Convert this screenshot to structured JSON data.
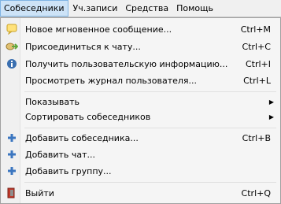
{
  "menubar": {
    "items": [
      {
        "label": "Собеседники",
        "active": true
      },
      {
        "label": "Уч.записи"
      },
      {
        "label": "Средства"
      },
      {
        "label": "Помощь"
      }
    ]
  },
  "menu": {
    "new_message": {
      "label": "Новое мгновенное сообщение...",
      "shortcut": "Ctrl+M",
      "icon": "new-message-icon"
    },
    "join_chat": {
      "label": "Присоединиться к чату...",
      "shortcut": "Ctrl+C",
      "icon": "join-chat-icon"
    },
    "user_info": {
      "label": "Получить пользовательскую информацию...",
      "shortcut": "Ctrl+I",
      "icon": "info-icon"
    },
    "view_log": {
      "label": "Просмотреть журнал пользователя...",
      "shortcut": "Ctrl+L"
    },
    "show": {
      "label": "Показывать"
    },
    "sort": {
      "label": "Сортировать собеседников"
    },
    "add_buddy": {
      "label": "Добавить собеседника...",
      "shortcut": "Ctrl+B",
      "icon": "add-icon"
    },
    "add_chat": {
      "label": "Добавить чат...",
      "icon": "add-icon"
    },
    "add_group": {
      "label": "Добавить группу...",
      "icon": "add-icon"
    },
    "quit": {
      "label": "Выйти",
      "shortcut": "Ctrl+Q",
      "icon": "quit-icon"
    }
  },
  "colors": {
    "menubar_active_bg": "#cde3f7",
    "add_icon": "#3b76c0",
    "info_icon": "#3a6fb0",
    "join_chat_icon": "#5fa83a",
    "quit_icon": "#c0392b"
  }
}
